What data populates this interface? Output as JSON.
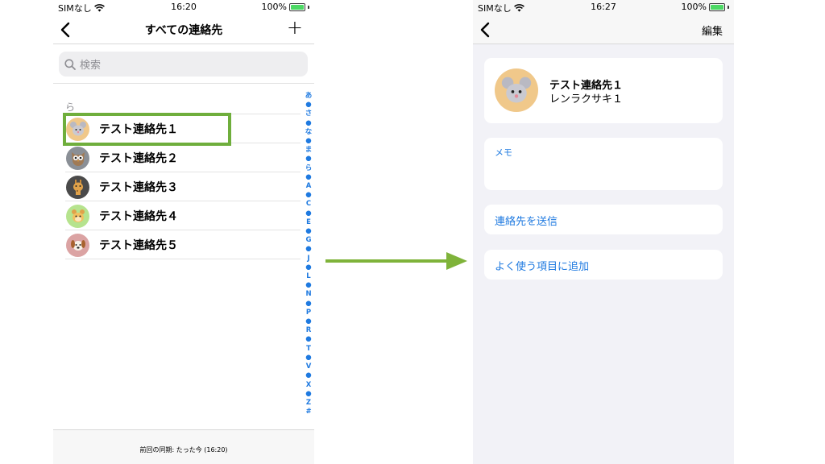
{
  "left_screen": {
    "status": {
      "carrier": "SIMなし",
      "time": "16:20",
      "battery": "100%"
    },
    "nav": {
      "title": "すべての連絡先",
      "add_symbol": "+"
    },
    "search": {
      "placeholder": "検索"
    },
    "section_header": "ら",
    "contacts": [
      {
        "name": "テスト連絡先１",
        "avatar_icon": "mouse-icon",
        "avatar_color": "#f0c88a"
      },
      {
        "name": "テスト連絡先２",
        "avatar_icon": "owl-icon",
        "avatar_color": "#8a8f96"
      },
      {
        "name": "テスト連絡先３",
        "avatar_icon": "giraffe-icon",
        "avatar_color": "#4a4a4a"
      },
      {
        "name": "テスト連絡先４",
        "avatar_icon": "hamster-icon",
        "avatar_color": "#b6e38e"
      },
      {
        "name": "テスト連絡先５",
        "avatar_icon": "dog-icon",
        "avatar_color": "#dba3a3"
      }
    ],
    "index_letters": [
      "あ",
      "●",
      "さ",
      "●",
      "な",
      "●",
      "ま",
      "●",
      "ら",
      "●",
      "A",
      "●",
      "C",
      "●",
      "E",
      "●",
      "G",
      "●",
      "J",
      "●",
      "L",
      "●",
      "N",
      "●",
      "P",
      "●",
      "R",
      "●",
      "T",
      "●",
      "V",
      "●",
      "X",
      "●",
      "Z",
      "#"
    ],
    "footer": "前回の同期: たった今 (16:20)"
  },
  "right_screen": {
    "status": {
      "carrier": "SIMなし",
      "time": "16:27",
      "battery": "100%"
    },
    "nav": {
      "edit_label": "編集"
    },
    "profile": {
      "name": "テスト連絡先１",
      "kana": "レンラクサキ１",
      "avatar_icon": "mouse-icon"
    },
    "memo_label": "メモ",
    "send_contact": "連絡先を送信",
    "add_favorite": "よく使う項目に追加"
  },
  "colors": {
    "highlight": "#6fae3c",
    "arrow": "#7fb33a",
    "link": "#1f7ae0",
    "group_bg": "#f2f2f7"
  }
}
